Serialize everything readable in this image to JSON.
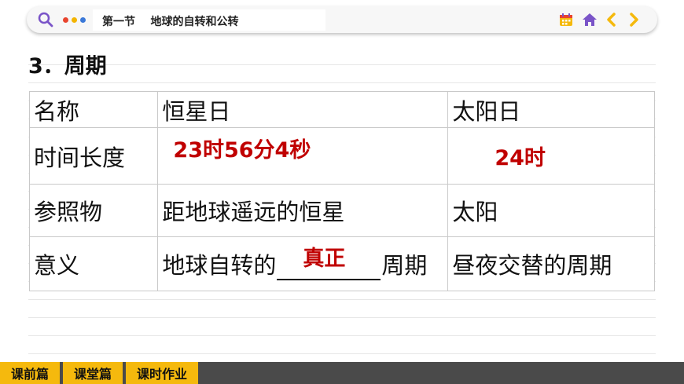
{
  "header": {
    "title": "第一节    地球的自转和公转",
    "accent_colors": {
      "dot1": "#e8442e",
      "dot2": "#f3b400",
      "dot3": "#3a78d8",
      "nav": "#f5b90d",
      "home": "#7a54c8"
    }
  },
  "section": {
    "heading": "3．周期"
  },
  "table": {
    "headers": [
      "名称",
      "恒星日",
      "太阳日"
    ],
    "rows": [
      {
        "label": "时间长度",
        "col1_answer": "23时56分4秒",
        "col2_answer": "24时"
      },
      {
        "label": "参照物",
        "col1": "距地球遥远的恒星",
        "col2": "太阳"
      },
      {
        "label": "意义",
        "col1_prefix": "地球自转的",
        "col1_blank_answer": "真正",
        "col1_suffix": "周期",
        "col2": "昼夜交替的周期"
      }
    ]
  },
  "bottom_nav": {
    "tabs": [
      "课前篇",
      "课堂篇",
      "课时作业"
    ]
  }
}
